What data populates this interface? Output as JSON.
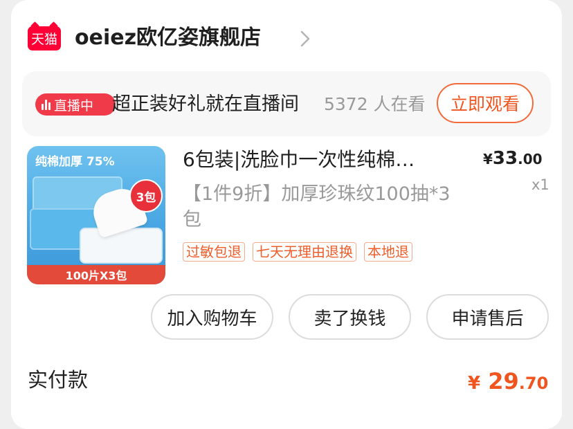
{
  "store": {
    "logo_text": "天猫",
    "name": "oeiez欧亿姿旗舰店"
  },
  "live": {
    "badge": "直播中",
    "text": "超正装好礼就在直播间",
    "viewers": "5372 人在看",
    "watch_button": "立即观看"
  },
  "product": {
    "thumb_banner": "纯棉加厚 75%",
    "thumb_badge": "3包",
    "thumb_footer": "100片X3包",
    "title": "6包装|洗脸巾一次性纯棉…",
    "price_currency": "¥",
    "price_int": "33",
    "price_dec": ".00",
    "quantity": "x1",
    "subtitle": "【1件9折】加厚珍珠纹100抽*3包",
    "tags": [
      "过敏包退",
      "七天无理由退换",
      "本地退"
    ]
  },
  "actions": {
    "add_to_cart": "加入购物车",
    "resell": "卖了换钱",
    "after_sale": "申请售后"
  },
  "payment": {
    "label": "实付款",
    "currency": "¥",
    "amount_int": "29",
    "amount_dec": ".70"
  },
  "colors": {
    "tmall_red": "#ff0036",
    "live_red": "#f03a4a",
    "accent_orange": "#f0551f"
  }
}
